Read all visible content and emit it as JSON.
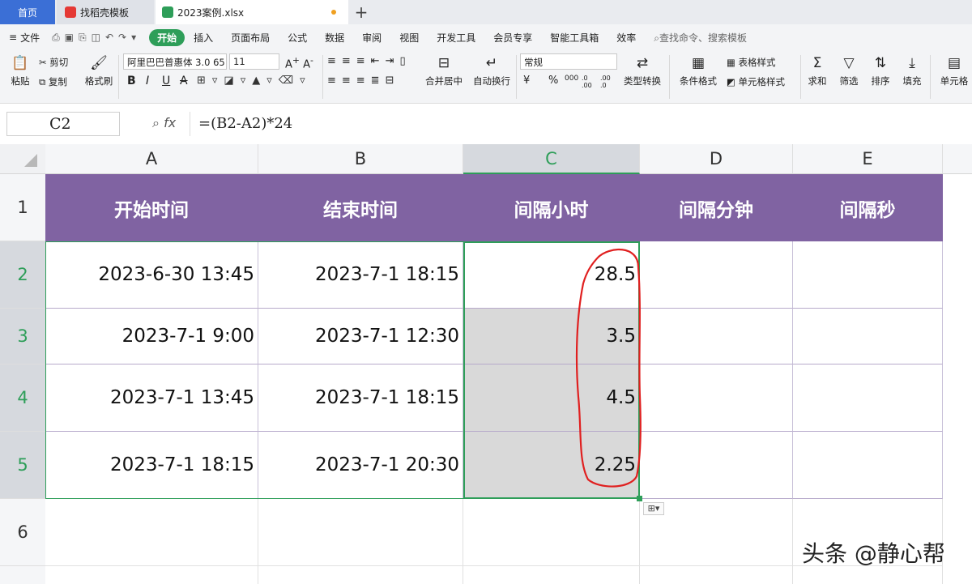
{
  "tabs": {
    "home": "首页",
    "template": "找稻壳模板",
    "file": "2023案例.xlsx",
    "plus": "+"
  },
  "menu": {
    "hamburger": "≡",
    "file": "文件",
    "items": [
      "开始",
      "插入",
      "页面布局",
      "公式",
      "数据",
      "审阅",
      "视图",
      "开发工具",
      "会员专享",
      "智能工具箱",
      "效率"
    ],
    "search_placeholder": "查找命令、搜索模板"
  },
  "toolbar": {
    "paste": "粘贴",
    "cut": "剪切",
    "copy": "复制",
    "format_painter": "格式刷",
    "font_name": "阿里巴巴普惠体 3.0 65",
    "font_size": "11",
    "bold": "B",
    "italic": "I",
    "underline": "U",
    "strikethrough": "A",
    "merge_center": "合并居中",
    "wrap_text": "自动换行",
    "number_format": "常规",
    "currency": "¥",
    "percent": "%",
    "thousands": "000",
    "dec_add": ".0 .00",
    "dec_remove": ".00 .0",
    "type_convert": "类型转换",
    "conditional_format": "条件格式",
    "table_style": "表格样式",
    "cell_style": "单元格样式",
    "sum": "求和",
    "filter": "筛选",
    "sort": "排序",
    "fill": "填充",
    "cell": "单元格"
  },
  "formula_bar": {
    "name_box": "C2",
    "fx": "fx",
    "formula": "=(B2-A2)*24"
  },
  "sheet": {
    "columns": [
      "A",
      "B",
      "C",
      "D",
      "E"
    ],
    "rows": [
      "1",
      "2",
      "3",
      "4",
      "5",
      "6"
    ],
    "headers": [
      "开始时间",
      "结束时间",
      "间隔小时",
      "间隔分钟",
      "间隔秒"
    ],
    "data": [
      [
        "2023-6-30 13:45",
        "2023-7-1 18:15",
        "28.5",
        "",
        ""
      ],
      [
        "2023-7-1 9:00",
        "2023-7-1 12:30",
        "3.5",
        "",
        ""
      ],
      [
        "2023-7-1 13:45",
        "2023-7-1 18:15",
        "4.5",
        "",
        ""
      ],
      [
        "2023-7-1 18:15",
        "2023-7-1 20:30",
        "2.25",
        "",
        ""
      ]
    ]
  },
  "colors": {
    "header_fill": "#8063a2",
    "active_green": "#2e9e59",
    "annotation_red": "#e02020"
  },
  "watermark": "头条 @静心帮"
}
